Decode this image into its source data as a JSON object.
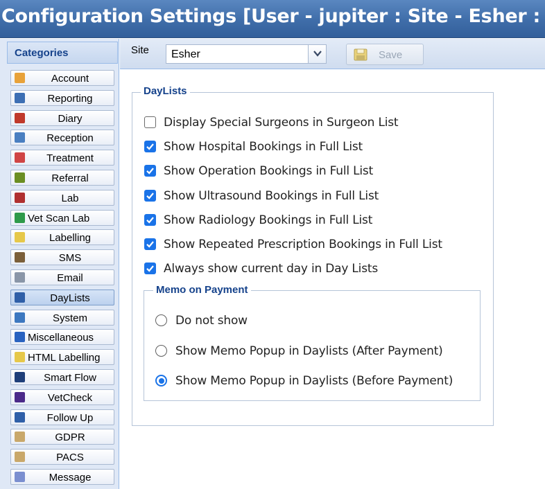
{
  "window": {
    "title": "Configuration Settings [User - jupiter : Site - Esher : Profile -"
  },
  "sidebar": {
    "header": "Categories",
    "items": [
      {
        "label": "Account",
        "icon": "account-icon",
        "color": "#e8a23a"
      },
      {
        "label": "Reporting",
        "icon": "report-icon",
        "color": "#3d6fb4"
      },
      {
        "label": "Diary",
        "icon": "calendar-icon",
        "color": "#c0392b"
      },
      {
        "label": "Reception",
        "icon": "receptionist-icon",
        "color": "#4a7fc1"
      },
      {
        "label": "Treatment",
        "icon": "treatment-icon",
        "color": "#d04545"
      },
      {
        "label": "Referral",
        "icon": "magnifier-icon",
        "color": "#6b8e23"
      },
      {
        "label": "Lab",
        "icon": "lab-icon",
        "color": "#b03030"
      },
      {
        "label": "Vet Scan Lab",
        "icon": "vetscan-icon",
        "color": "#2e9a4a"
      },
      {
        "label": "Labelling",
        "icon": "label-icon",
        "color": "#e6c84a"
      },
      {
        "label": "SMS",
        "icon": "phone-icon",
        "color": "#7b5f3a"
      },
      {
        "label": "Email",
        "icon": "envelope-icon",
        "color": "#8a96a8"
      },
      {
        "label": "DayLists",
        "icon": "list-icon",
        "color": "#2f5fa8"
      },
      {
        "label": "System",
        "icon": "system-icon",
        "color": "#3d78c0"
      },
      {
        "label": "Miscellaneous",
        "icon": "info-icon",
        "color": "#2a63c0"
      },
      {
        "label": "HTML Labelling",
        "icon": "html-label-icon",
        "color": "#e6c84a"
      },
      {
        "label": "Smart Flow",
        "icon": "smartflow-icon",
        "color": "#1f3f7a"
      },
      {
        "label": "VetCheck",
        "icon": "vetcheck-icon",
        "color": "#4b2a8a"
      },
      {
        "label": "Follow Up",
        "icon": "followup-icon",
        "color": "#2f5fa8"
      },
      {
        "label": "GDPR",
        "icon": "gdpr-icon",
        "color": "#c9a86a"
      },
      {
        "label": "PACS",
        "icon": "pacs-icon",
        "color": "#c9a86a"
      },
      {
        "label": "Message",
        "icon": "message-icon",
        "color": "#7b8fd0"
      }
    ],
    "active_index": 11
  },
  "toolbar": {
    "site_label": "Site",
    "site_value": "Esher",
    "save_label": "Save"
  },
  "daylists": {
    "legend": "DayLists",
    "options": [
      {
        "label": "Display Special Surgeons in Surgeon List",
        "checked": false
      },
      {
        "label": "Show Hospital Bookings in Full List",
        "checked": true
      },
      {
        "label": "Show Operation Bookings in Full List",
        "checked": true
      },
      {
        "label": "Show Ultrasound Bookings in Full List",
        "checked": true
      },
      {
        "label": "Show Radiology Bookings in Full List",
        "checked": true
      },
      {
        "label": "Show Repeated Prescription Bookings in Full List",
        "checked": true
      },
      {
        "label": "Always show current day in Day Lists",
        "checked": true
      }
    ],
    "memo": {
      "legend": "Memo on Payment",
      "options": [
        {
          "label": "Do not show",
          "selected": false
        },
        {
          "label": "Show Memo Popup in Daylists (After Payment)",
          "selected": false
        },
        {
          "label": "Show Memo Popup in Daylists (Before Payment)",
          "selected": true
        }
      ]
    }
  },
  "colors": {
    "accent": "#1a73e8",
    "header_text": "#15428b",
    "titlebar": "#3f6da9"
  }
}
